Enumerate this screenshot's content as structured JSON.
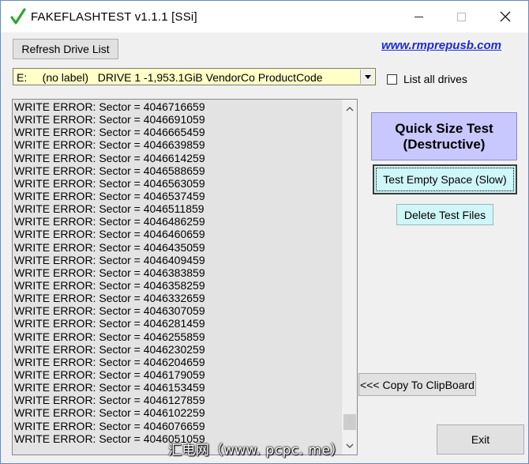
{
  "window": {
    "title": "FAKEFLASHTEST v1.1.1  [SSi]",
    "icons": {
      "app": "checkmark-icon",
      "minimize": "minimize-icon",
      "maximize": "maximize-icon",
      "close": "close-icon"
    }
  },
  "toolbar": {
    "refresh_label": "Refresh Drive List",
    "link_text": "www.rmprepusb.com"
  },
  "drive_select": {
    "selected_value": "E:     (no label)   DRIVE 1 -1,953.1GiB VendorCo ProductCode",
    "list_all_label": "List all drives",
    "list_all_checked": false
  },
  "log": {
    "lines": [
      "WRITE ERROR: Sector = 4046716659",
      "WRITE ERROR: Sector = 4046691059",
      "WRITE ERROR: Sector = 4046665459",
      "WRITE ERROR: Sector = 4046639859",
      "WRITE ERROR: Sector = 4046614259",
      "WRITE ERROR: Sector = 4046588659",
      "WRITE ERROR: Sector = 4046563059",
      "WRITE ERROR: Sector = 4046537459",
      "WRITE ERROR: Sector = 4046511859",
      "WRITE ERROR: Sector = 4046486259",
      "WRITE ERROR: Sector = 4046460659",
      "WRITE ERROR: Sector = 4046435059",
      "WRITE ERROR: Sector = 4046409459",
      "WRITE ERROR: Sector = 4046383859",
      "WRITE ERROR: Sector = 4046358259",
      "WRITE ERROR: Sector = 4046332659",
      "WRITE ERROR: Sector = 4046307059",
      "WRITE ERROR: Sector = 4046281459",
      "WRITE ERROR: Sector = 4046255859",
      "WRITE ERROR: Sector = 4046230259",
      "WRITE ERROR: Sector = 4046204659",
      "WRITE ERROR: Sector = 4046179059",
      "WRITE ERROR: Sector = 4046153459",
      "WRITE ERROR: Sector = 4046127859",
      "WRITE ERROR: Sector = 4046102259",
      "WRITE ERROR: Sector = 4046076659",
      "WRITE ERROR: Sector = 4046051059"
    ]
  },
  "actions": {
    "quick_line1": "Quick Size Test",
    "quick_line2": "(Destructive)",
    "empty_label": "Test Empty Space (Slow)",
    "delete_label": "Delete Test Files",
    "copy_label": "<<< Copy To ClipBoard",
    "exit_label": "Exit"
  },
  "watermark": "汇电网（www. pcpc. me）",
  "colors": {
    "combo_bg": "#ffffc8",
    "quick_bg": "#c8c8ff",
    "cyan_btn_bg": "#cff6f8",
    "link": "#1a29d6",
    "check": "#2fa52f"
  }
}
